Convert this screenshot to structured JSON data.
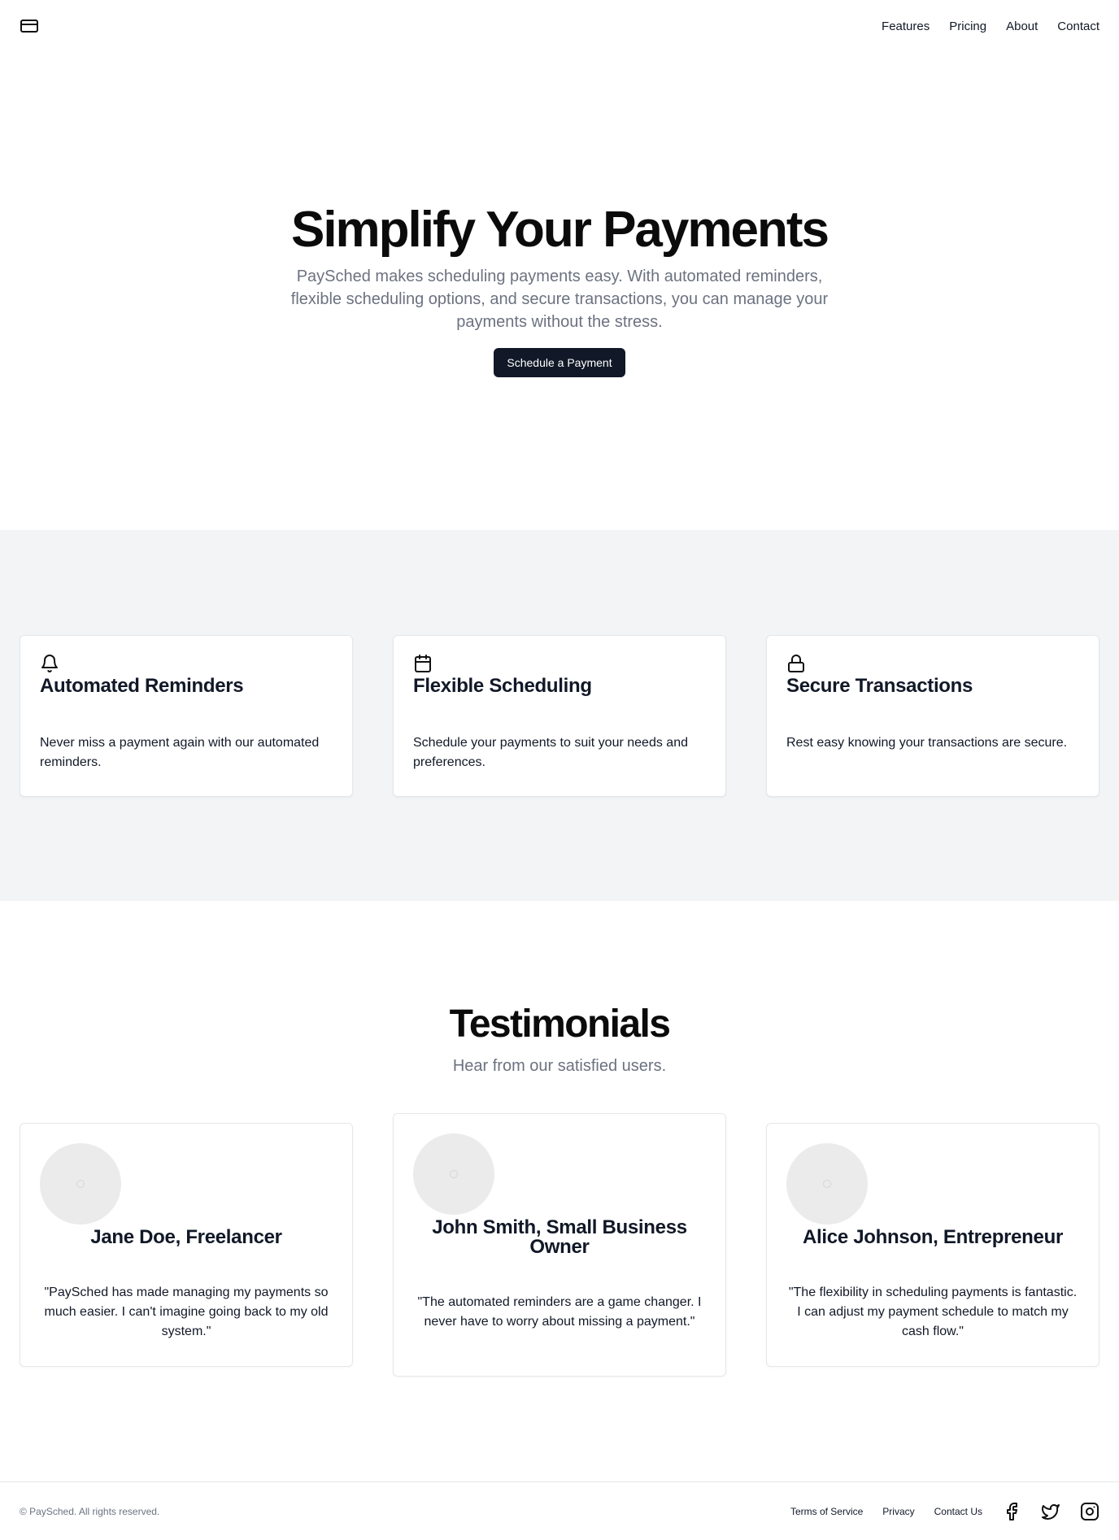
{
  "header": {
    "logo_icon": "credit-card-icon",
    "nav": [
      "Features",
      "Pricing",
      "About",
      "Contact"
    ]
  },
  "hero": {
    "title": "Simplify Your Payments",
    "subtitle": "PaySched makes scheduling payments easy. With automated reminders, flexible scheduling options, and secure transactions, you can manage your payments without the stress.",
    "cta_label": "Schedule a Payment"
  },
  "features": [
    {
      "icon": "bell-icon",
      "title": "Automated Reminders",
      "text": "Never miss a payment again with our automated reminders."
    },
    {
      "icon": "calendar-icon",
      "title": "Flexible Scheduling",
      "text": "Schedule your payments to suit your needs and preferences."
    },
    {
      "icon": "lock-icon",
      "title": "Secure Transactions",
      "text": "Rest easy knowing your transactions are secure."
    }
  ],
  "testimonials": {
    "title": "Testimonials",
    "subtitle": "Hear from our satisfied users.",
    "items": [
      {
        "name": "Jane Doe, Freelancer",
        "quote": "\"PaySched has made managing my payments so much easier. I can't imagine going back to my old system.\""
      },
      {
        "name": "John Smith, Small Business Owner",
        "quote": "\"The automated reminders are a game changer. I never have to worry about missing a payment.\""
      },
      {
        "name": "Alice Johnson, Entrepreneur",
        "quote": "\"The flexibility in scheduling payments is fantastic. I can adjust my payment schedule to match my cash flow.\""
      }
    ]
  },
  "footer": {
    "copyright": "© PaySched. All rights reserved.",
    "links": [
      "Terms of Service",
      "Privacy",
      "Contact Us"
    ],
    "social_icons": [
      "facebook-icon",
      "twitter-icon",
      "instagram-icon"
    ]
  },
  "colors": {
    "primary": "#111827",
    "muted_text": "#6b7280",
    "section_bg": "#f3f4f6",
    "border": "#e5e7eb"
  }
}
